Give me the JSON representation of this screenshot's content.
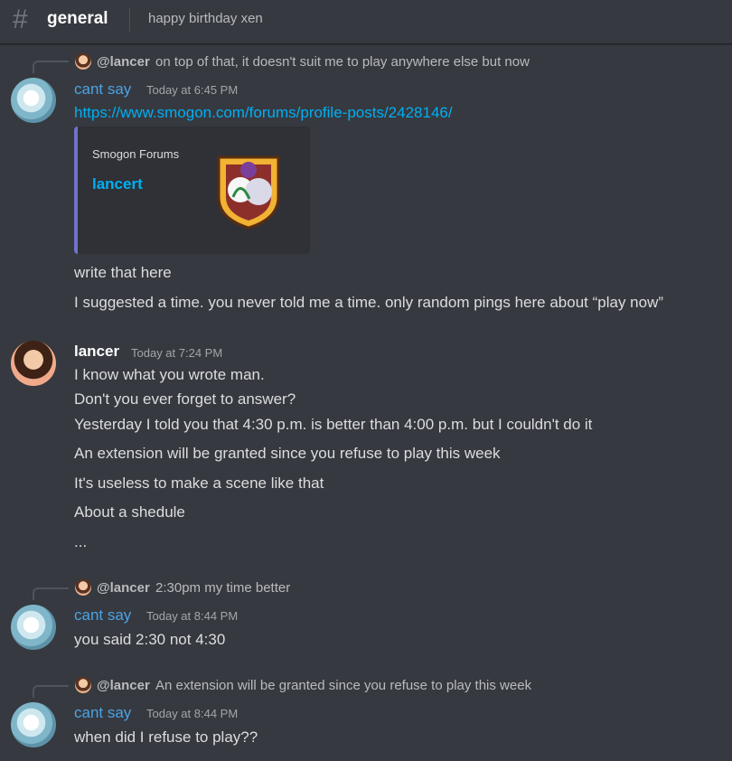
{
  "header": {
    "channel_icon": "hash-icon",
    "channel_name": "general",
    "topic": "happy birthday xen"
  },
  "messages": [
    {
      "reply": {
        "author": "@lancer",
        "text": "on top of that, it doesn't suit me to play anywhere else but now"
      },
      "author": "cant say",
      "timestamp": "Today at 6:45 PM",
      "link": "https://www.smogon.com/forums/profile-posts/2428146/",
      "embed": {
        "provider": "Smogon Forums",
        "title": "lancert"
      },
      "lines": [
        "write that here",
        "I suggested a time. you never told me a time. only random pings here about “play now”"
      ]
    },
    {
      "author": "lancer",
      "timestamp": "Today at 7:24 PM",
      "lines": [
        "I know what you wrote man.",
        "Don't you ever forget to answer?",
        "Yesterday I told you that 4:30 p.m. is better than 4:00 p.m. but I couldn't do it",
        "An extension will be granted since you refuse to play this week",
        "It's useless to make a scene like that",
        "About a shedule",
        "..."
      ]
    },
    {
      "reply": {
        "author": "@lancer",
        "text": "2:30pm my time better"
      },
      "author": "cant say",
      "timestamp": "Today at 8:44 PM",
      "lines": [
        "you said 2:30 not 4:30"
      ]
    },
    {
      "reply": {
        "author": "@lancer",
        "text": "An extension will be granted since you refuse to play this week"
      },
      "author": "cant say",
      "timestamp": "Today at 8:44 PM",
      "lines": [
        "when did I refuse to play??"
      ]
    }
  ],
  "colors": {
    "background": "#36393f",
    "username_cant_say": "#4aa3e6",
    "link": "#00aff4",
    "embed_bg": "#2f3136"
  }
}
